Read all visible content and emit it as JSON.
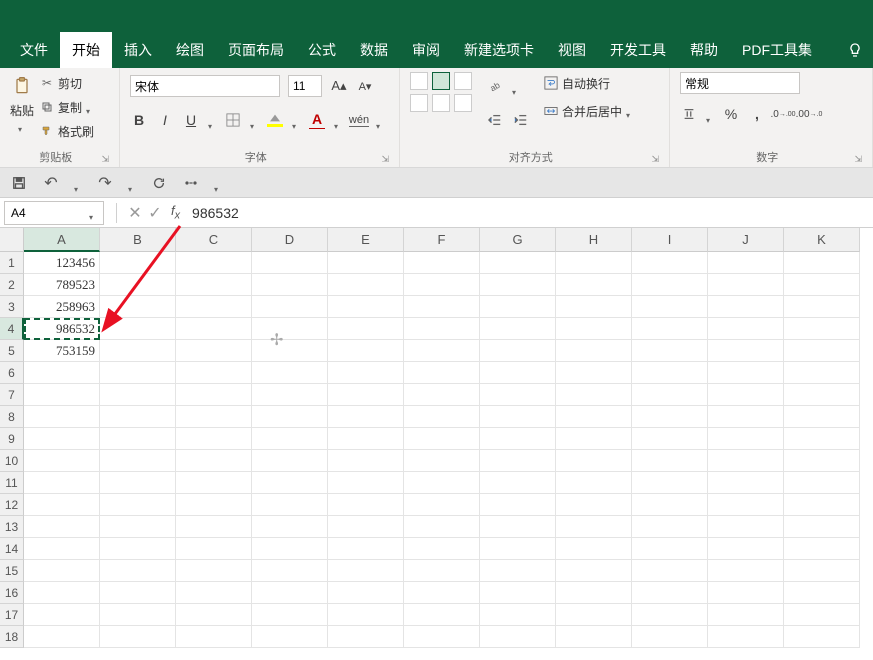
{
  "tabs": {
    "items": [
      "文件",
      "开始",
      "插入",
      "绘图",
      "页面布局",
      "公式",
      "数据",
      "审阅",
      "新建选项卡",
      "视图",
      "开发工具",
      "帮助",
      "PDF工具集"
    ],
    "active_index": 1
  },
  "ribbon": {
    "clipboard": {
      "title": "剪贴板",
      "paste": "粘贴",
      "cut": "剪切",
      "copy": "复制",
      "format_painter": "格式刷"
    },
    "font": {
      "title": "字体",
      "name": "宋体",
      "size": "11"
    },
    "alignment": {
      "title": "对齐方式",
      "wrap": "自动换行",
      "merge": "合并后居中"
    },
    "number": {
      "title": "数字",
      "format": "常规"
    }
  },
  "name_box": "A4",
  "formula_value": "986532",
  "columns": [
    "A",
    "B",
    "C",
    "D",
    "E",
    "F",
    "G",
    "H",
    "I",
    "J",
    "K"
  ],
  "row_count": 18,
  "selected_col": 0,
  "selected_row": 3,
  "cells": {
    "A1": "123456",
    "A2": "789523",
    "A3": "258963",
    "A4": "986532",
    "A5": "753159"
  }
}
